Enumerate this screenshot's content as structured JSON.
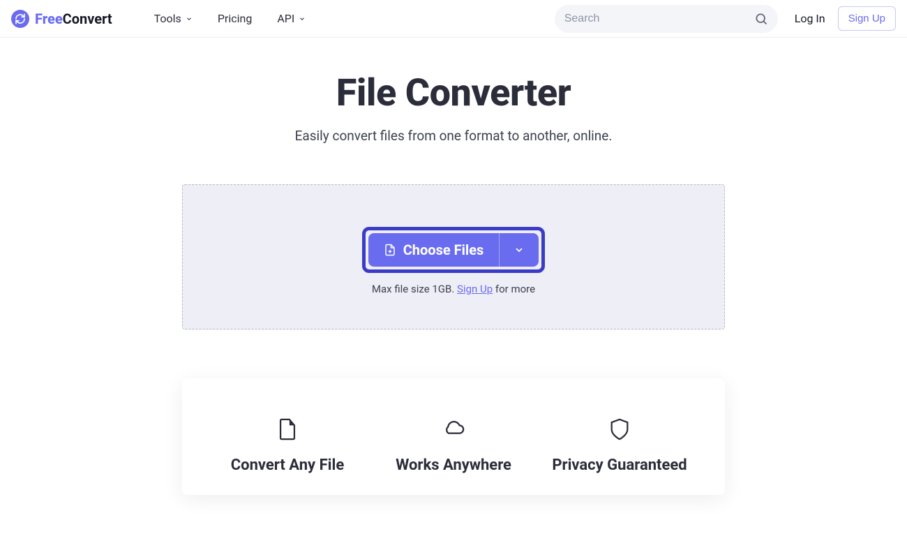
{
  "brand": {
    "free": "Free",
    "convert": "Convert"
  },
  "nav": {
    "tools": "Tools",
    "pricing": "Pricing",
    "api": "API"
  },
  "search": {
    "placeholder": "Search"
  },
  "auth": {
    "login": "Log In",
    "signup": "Sign Up"
  },
  "hero": {
    "title": "File Converter",
    "subtitle": "Easily convert files from one format to another, online."
  },
  "dropzone": {
    "choose_label": "Choose Files",
    "limit_prefix": "Max file size 1GB. ",
    "limit_link": "Sign Up",
    "limit_suffix": " for more"
  },
  "features": [
    {
      "icon": "file-icon",
      "title": "Convert Any File"
    },
    {
      "icon": "cloud-icon",
      "title": "Works Anywhere"
    },
    {
      "icon": "shield-icon",
      "title": "Privacy Guaranteed"
    }
  ],
  "colors": {
    "accent": "#6a6cf0",
    "accent_dark": "#3a3cc8"
  }
}
